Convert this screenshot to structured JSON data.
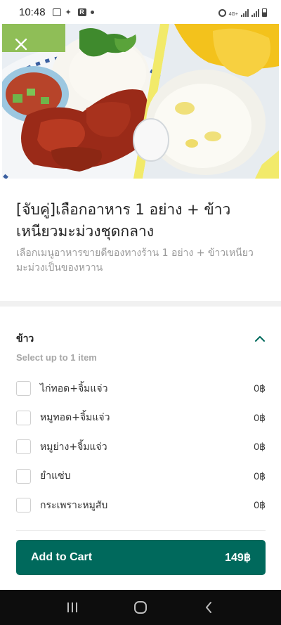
{
  "status_bar": {
    "time": "10:48",
    "network": "4G+"
  },
  "icons": {
    "close": "close-icon",
    "collapse": "chevron-up-icon",
    "recents": "recents-icon",
    "home": "home-icon",
    "back": "back-icon"
  },
  "product": {
    "title": "[จับคู่]เลือกอาหาร 1 อย่าง + ข้าวเหนียวมะม่วงชุดกลาง",
    "description": "เลือกเมนูอาหารขายดีของทางร้าน 1 อย่าง + ข้าวเหนียวมะม่วงเป็นของหวาน"
  },
  "option_group": {
    "title": "ข้าว",
    "hint": "Select up to 1 item",
    "options": [
      {
        "label": "ไก่ทอด+จิ้มแจ่ว",
        "price": "0฿",
        "checked": false
      },
      {
        "label": "หมูทอด+จิ้มแจ่ว",
        "price": "0฿",
        "checked": false
      },
      {
        "label": "หมูย่าง+จิ้มแจ่ว",
        "price": "0฿",
        "checked": false
      },
      {
        "label": "ยำแซ่บ",
        "price": "0฿",
        "checked": false
      },
      {
        "label": "กระเพราะหมูสับ",
        "price": "0฿",
        "checked": false
      }
    ]
  },
  "cart": {
    "label": "Add to Cart",
    "price": "149฿"
  },
  "colors": {
    "accent": "#00695c",
    "checkbox_border": "#cfcfcf"
  }
}
